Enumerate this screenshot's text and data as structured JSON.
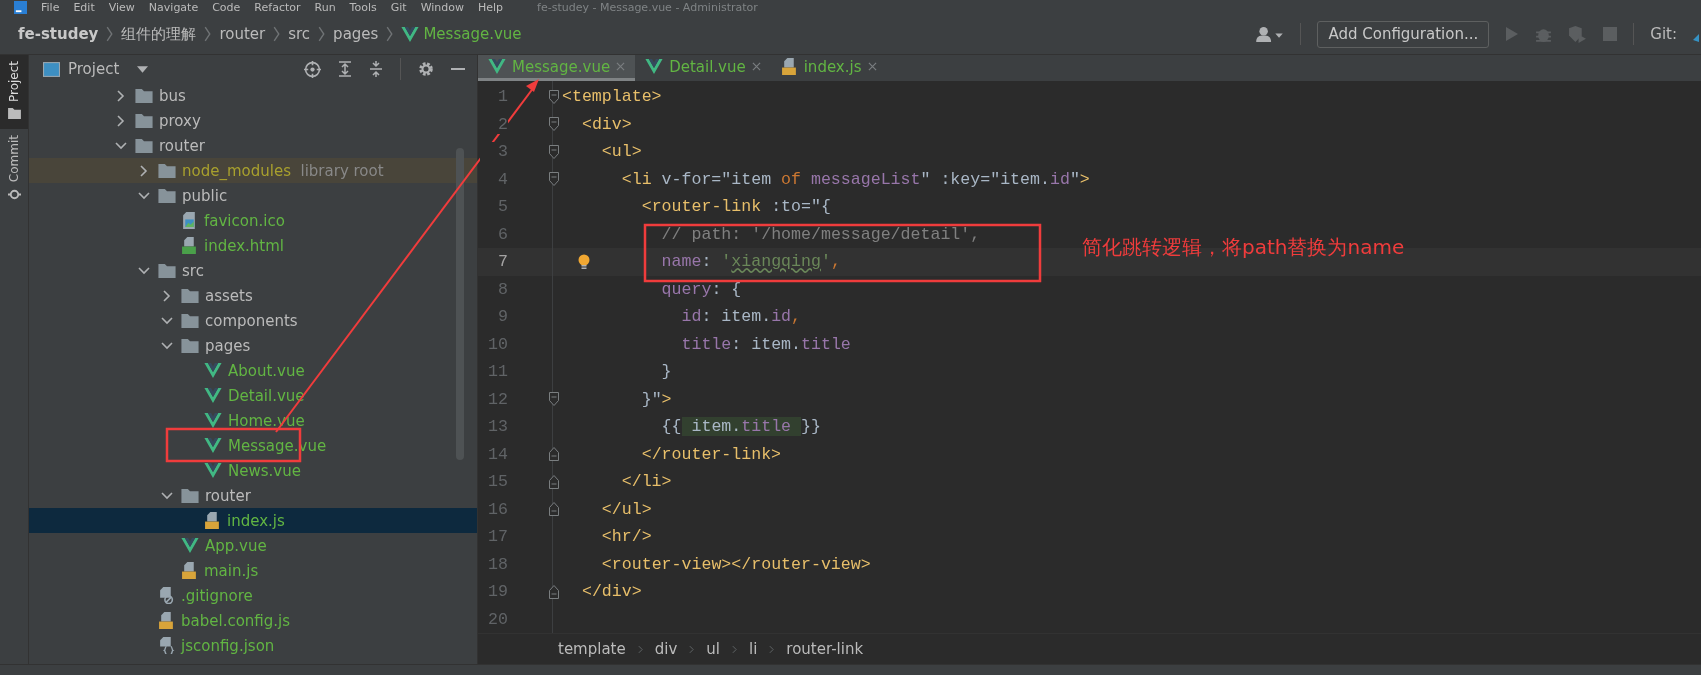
{
  "menu_bar": {
    "items": [
      "File",
      "Edit",
      "View",
      "Navigate",
      "Code",
      "Refactor",
      "Run",
      "Tools",
      "Git",
      "Window",
      "Help"
    ],
    "title": "fe-studey - Message.vue - Administrator"
  },
  "breadcrumb": [
    {
      "label": "fe-studey",
      "kind": "project"
    },
    {
      "label": "组件的理解",
      "kind": "folder"
    },
    {
      "label": "router",
      "kind": "folder"
    },
    {
      "label": "src",
      "kind": "folder"
    },
    {
      "label": "pages",
      "kind": "folder"
    },
    {
      "label": "Message.vue",
      "kind": "vue"
    }
  ],
  "toolbar": {
    "configuration_button": "Add Configuration...",
    "git_label": "Git:"
  },
  "side_tabs": [
    {
      "label": "Project",
      "kind": "project",
      "selected": true
    },
    {
      "label": "Commit",
      "kind": "commit",
      "selected": false
    }
  ],
  "project_panel": {
    "title": "Project",
    "tree": [
      {
        "label": "bus",
        "kind": "folder",
        "expanded": false,
        "selected": false
      },
      {
        "label": "proxy",
        "kind": "folder",
        "expanded": false,
        "selected": false
      },
      {
        "label": "router",
        "kind": "folder",
        "expanded": true,
        "selected": false,
        "children": [
          {
            "label": "node_modules",
            "note": "library root",
            "kind": "library",
            "expanded": false,
            "selected": false
          },
          {
            "label": "public",
            "kind": "folder",
            "expanded": true,
            "selected": false,
            "children": [
              {
                "label": "favicon.ico",
                "kind": "image",
                "selected": false
              },
              {
                "label": "index.html",
                "kind": "html",
                "selected": false
              }
            ]
          },
          {
            "label": "src",
            "kind": "folder",
            "expanded": true,
            "selected": false,
            "children": [
              {
                "label": "assets",
                "kind": "folder",
                "expanded": false,
                "selected": false
              },
              {
                "label": "components",
                "kind": "folder",
                "expanded": true,
                "selected": false
              },
              {
                "label": "pages",
                "kind": "folder",
                "expanded": true,
                "selected": false,
                "children": [
                  {
                    "label": "About.vue",
                    "kind": "vue",
                    "selected": false
                  },
                  {
                    "label": "Detail.vue",
                    "kind": "vue",
                    "selected": false
                  },
                  {
                    "label": "Home.vue",
                    "kind": "vue",
                    "selected": false
                  },
                  {
                    "label": "Message.vue",
                    "kind": "vue",
                    "selected": false
                  },
                  {
                    "label": "News.vue",
                    "kind": "vue",
                    "selected": false
                  }
                ]
              },
              {
                "label": "router",
                "kind": "folder",
                "expanded": true,
                "selected": false,
                "children": [
                  {
                    "label": "index.js",
                    "kind": "js",
                    "selected": true
                  }
                ]
              },
              {
                "label": "App.vue",
                "kind": "vue",
                "selected": false
              },
              {
                "label": "main.js",
                "kind": "js",
                "selected": false
              }
            ]
          },
          {
            "label": ".gitignore",
            "kind": "gitignore",
            "selected": false
          },
          {
            "label": "babel.config.js",
            "kind": "js",
            "selected": false
          },
          {
            "label": "jsconfig.json",
            "kind": "json",
            "selected": false
          }
        ]
      }
    ]
  },
  "editor_tabs": [
    {
      "label": "Message.vue",
      "kind": "vue",
      "selected": true
    },
    {
      "label": "Detail.vue",
      "kind": "vue",
      "selected": false
    },
    {
      "label": "index.js",
      "kind": "js",
      "selected": false
    }
  ],
  "code_lines": [
    {
      "number": "1",
      "fold_start": true,
      "fold_end": false,
      "current": false,
      "bulb": false,
      "tokens": [
        {
          "text": "<template>",
          "kind": "tag"
        }
      ]
    },
    {
      "number": "2",
      "fold_start": true,
      "fold_end": false,
      "current": false,
      "bulb": false,
      "tokens": [
        {
          "text": "  <div>",
          "kind": "tag"
        }
      ]
    },
    {
      "number": "3",
      "fold_start": true,
      "fold_end": false,
      "current": false,
      "bulb": false,
      "tokens": [
        {
          "text": "    <ul>",
          "kind": "tag"
        }
      ]
    },
    {
      "number": "4",
      "fold_start": true,
      "fold_end": false,
      "current": false,
      "bulb": false,
      "tokens": [
        {
          "text": "      <li",
          "kind": "tag"
        },
        {
          "text": " v-for=\"item ",
          "kind": "plain"
        },
        {
          "text": "of",
          "kind": "keyword"
        },
        {
          "text": " messageList",
          "kind": "prop"
        },
        {
          "text": "\" :key=\"item.",
          "kind": "plain"
        },
        {
          "text": "id",
          "kind": "prop"
        },
        {
          "text": "\"",
          "kind": "plain"
        },
        {
          "text": ">",
          "kind": "tag"
        }
      ]
    },
    {
      "number": "5",
      "fold_start": false,
      "fold_end": false,
      "current": false,
      "bulb": false,
      "tokens": [
        {
          "text": "        <router-link",
          "kind": "tag"
        },
        {
          "text": " :to=\"{",
          "kind": "plain"
        }
      ]
    },
    {
      "number": "6",
      "fold_start": false,
      "fold_end": false,
      "current": false,
      "bulb": false,
      "tokens": [
        {
          "text": "          // path: '/home/message/detail',",
          "kind": "comment"
        }
      ]
    },
    {
      "number": "7",
      "fold_start": false,
      "fold_end": false,
      "current": true,
      "bulb": true,
      "tokens": [
        {
          "text": "          name",
          "kind": "prop"
        },
        {
          "text": ": ",
          "kind": "plain"
        },
        {
          "text": "'",
          "kind": "string"
        },
        {
          "text": "xiangqing",
          "kind": "typo"
        },
        {
          "text": "'",
          "kind": "string"
        },
        {
          "text": ",",
          "kind": "keyword"
        }
      ]
    },
    {
      "number": "8",
      "fold_start": false,
      "fold_end": false,
      "current": false,
      "bulb": false,
      "tokens": [
        {
          "text": "          query",
          "kind": "prop"
        },
        {
          "text": ": {",
          "kind": "plain"
        }
      ]
    },
    {
      "number": "9",
      "fold_start": false,
      "fold_end": false,
      "current": false,
      "bulb": false,
      "tokens": [
        {
          "text": "            id",
          "kind": "prop"
        },
        {
          "text": ": item.",
          "kind": "plain"
        },
        {
          "text": "id",
          "kind": "prop"
        },
        {
          "text": ",",
          "kind": "keyword"
        }
      ]
    },
    {
      "number": "10",
      "fold_start": false,
      "fold_end": false,
      "current": false,
      "bulb": false,
      "tokens": [
        {
          "text": "            title",
          "kind": "prop"
        },
        {
          "text": ": item.",
          "kind": "plain"
        },
        {
          "text": "title",
          "kind": "prop"
        }
      ]
    },
    {
      "number": "11",
      "fold_start": false,
      "fold_end": false,
      "current": false,
      "bulb": false,
      "tokens": [
        {
          "text": "          }",
          "kind": "plain"
        }
      ]
    },
    {
      "number": "12",
      "fold_start": true,
      "fold_end": false,
      "current": false,
      "bulb": false,
      "tokens": [
        {
          "text": "        }\"",
          "kind": "plain"
        },
        {
          "text": ">",
          "kind": "tag"
        }
      ]
    },
    {
      "number": "13",
      "fold_start": false,
      "fold_end": false,
      "current": false,
      "bulb": false,
      "tokens": [
        {
          "text": "          {{",
          "kind": "plain"
        },
        {
          "text": " item.",
          "kind": "inject"
        },
        {
          "text": "title ",
          "kind": "inject-prop"
        },
        {
          "text": "}}",
          "kind": "plain"
        }
      ]
    },
    {
      "number": "14",
      "fold_start": false,
      "fold_end": true,
      "current": false,
      "bulb": false,
      "tokens": [
        {
          "text": "        </router-link>",
          "kind": "tag"
        }
      ]
    },
    {
      "number": "15",
      "fold_start": false,
      "fold_end": true,
      "current": false,
      "bulb": false,
      "tokens": [
        {
          "text": "      </li>",
          "kind": "tag"
        }
      ]
    },
    {
      "number": "16",
      "fold_start": false,
      "fold_end": true,
      "current": false,
      "bulb": false,
      "tokens": [
        {
          "text": "    </ul>",
          "kind": "tag"
        }
      ]
    },
    {
      "number": "17",
      "fold_start": false,
      "fold_end": false,
      "current": false,
      "bulb": false,
      "tokens": [
        {
          "text": "    <hr/>",
          "kind": "tag"
        }
      ]
    },
    {
      "number": "18",
      "fold_start": false,
      "fold_end": false,
      "current": false,
      "bulb": false,
      "tokens": [
        {
          "text": "    <router-view></router-view>",
          "kind": "tag"
        }
      ]
    },
    {
      "number": "19",
      "fold_start": false,
      "fold_end": true,
      "current": false,
      "bulb": false,
      "tokens": [
        {
          "text": "  </div>",
          "kind": "tag"
        }
      ]
    },
    {
      "number": "20",
      "fold_start": false,
      "fold_end": false,
      "current": false,
      "bulb": false
    }
  ],
  "editor_breadcrumb": [
    "template",
    "div",
    "ul",
    "li",
    "router-link"
  ],
  "annotation": {
    "note": "简化跳转逻辑，将path替换为name"
  }
}
